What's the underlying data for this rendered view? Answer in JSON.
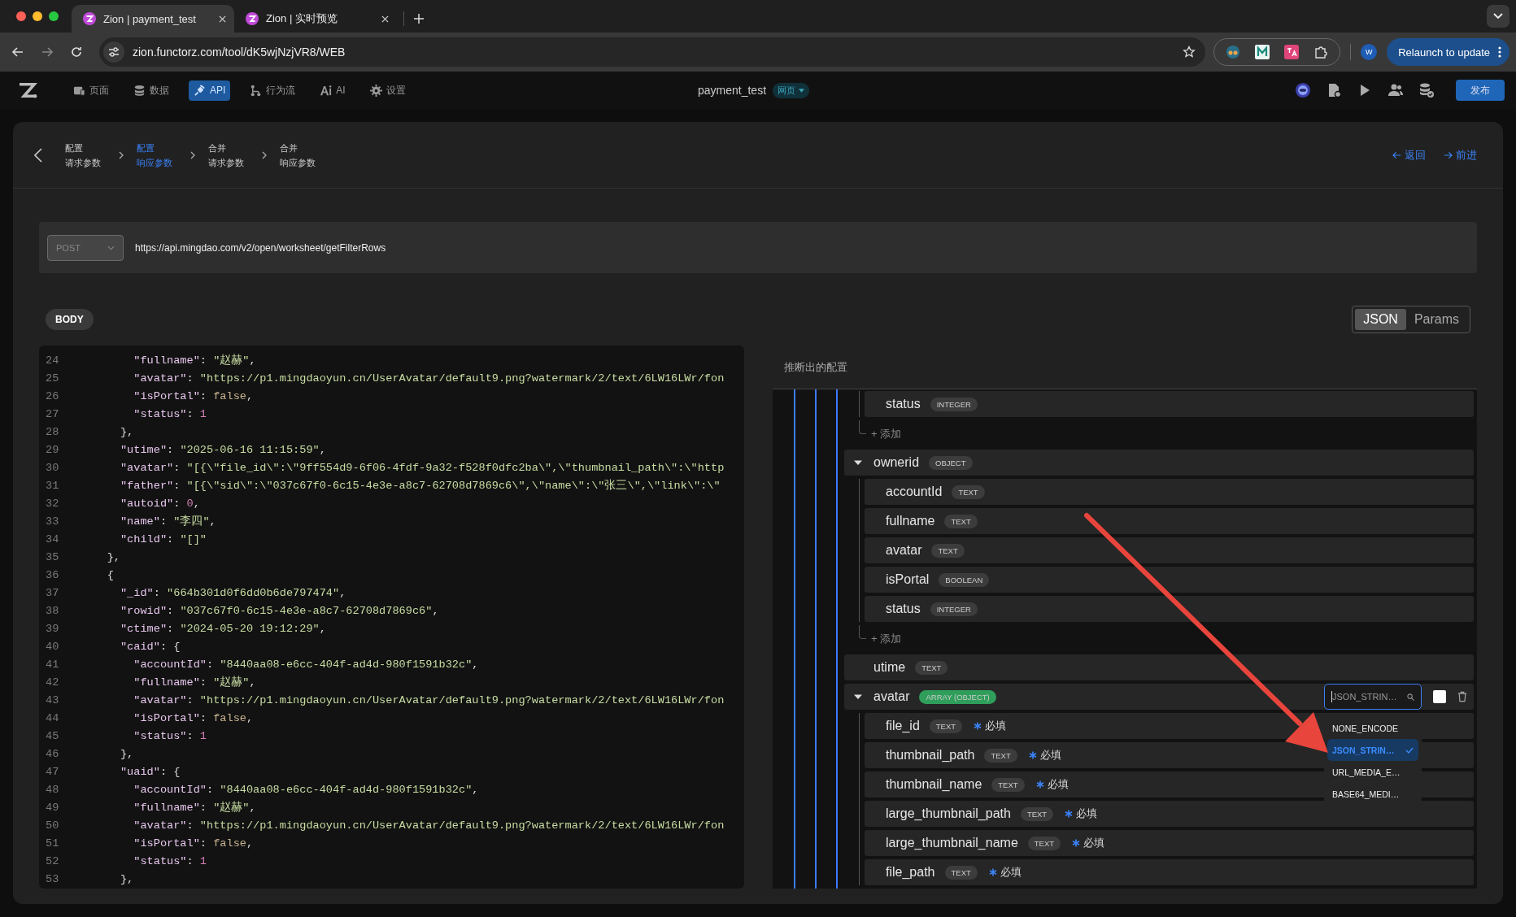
{
  "browser": {
    "tabs": [
      {
        "title": "Zion | payment_test",
        "selected": true
      },
      {
        "title": "Zion | 实时预览",
        "selected": false
      }
    ],
    "url": "zion.functorz.com/tool/dK5wjNzjVR8/WEB",
    "profile_initial": "W",
    "relaunch_label": "Relaunch to update"
  },
  "app_header": {
    "nav": [
      {
        "label": "页面",
        "selected": false
      },
      {
        "label": "数据",
        "selected": false
      },
      {
        "label": "API",
        "selected": true
      },
      {
        "label": "行为流",
        "selected": false
      },
      {
        "label": "AI",
        "selected": false
      },
      {
        "label": "设置",
        "selected": false
      }
    ],
    "project_title": "payment_test",
    "project_tag": "网页",
    "publish_label": "发布"
  },
  "steps": [
    {
      "title": "配置",
      "subtitle": "请求参数",
      "selected": false
    },
    {
      "title": "配置",
      "subtitle": "响应参数",
      "selected": true
    },
    {
      "title": "合并",
      "subtitle": "请求参数",
      "selected": false
    },
    {
      "title": "合并",
      "subtitle": "响应参数",
      "selected": false
    }
  ],
  "back_label": "返回",
  "forward_label": "前进",
  "request": {
    "method": "POST",
    "url": "https://api.mingdao.com/v2/open/worksheet/getFilterRows"
  },
  "body_label": "BODY",
  "format_toggle": [
    {
      "label": "JSON",
      "selected": true
    },
    {
      "label": "Params",
      "selected": false
    }
  ],
  "code_lines": [
    {
      "n": "24",
      "code": "        \"fullname\": \"赵赫\","
    },
    {
      "n": "25",
      "code": "        \"avatar\": \"https://p1.mingdaoyun.cn/UserAvatar/default9.png?watermark/2/text/6LW16LWr/fon"
    },
    {
      "n": "26",
      "code": "        \"isPortal\": false,"
    },
    {
      "n": "27",
      "code": "        \"status\": 1"
    },
    {
      "n": "28",
      "code": "      },"
    },
    {
      "n": "29",
      "code": "      \"utime\": \"2025-06-16 11:15:59\","
    },
    {
      "n": "30",
      "code": "      \"avatar\": \"[{\\\"file_id\\\":\\\"9ff554d9-6f06-4fdf-9a32-f528f0dfc2ba\\\",\\\"thumbnail_path\\\":\\\"http"
    },
    {
      "n": "31",
      "code": "      \"father\": \"[{\\\"sid\\\":\\\"037c67f0-6c15-4e3e-a8c7-62708d7869c6\\\",\\\"name\\\":\\\"张三\\\",\\\"link\\\":\\\""
    },
    {
      "n": "32",
      "code": "      \"autoid\": 0,"
    },
    {
      "n": "33",
      "code": "      \"name\": \"李四\","
    },
    {
      "n": "34",
      "code": "      \"child\": \"[]\""
    },
    {
      "n": "35",
      "code": "    },"
    },
    {
      "n": "36",
      "code": "    {"
    },
    {
      "n": "37",
      "code": "      \"_id\": \"664b301d0f6dd0b6de797474\","
    },
    {
      "n": "38",
      "code": "      \"rowid\": \"037c67f0-6c15-4e3e-a8c7-62708d7869c6\","
    },
    {
      "n": "39",
      "code": "      \"ctime\": \"2024-05-20 19:12:29\","
    },
    {
      "n": "40",
      "code": "      \"caid\": {"
    },
    {
      "n": "41",
      "code": "        \"accountId\": \"8440aa08-e6cc-404f-ad4d-980f1591b32c\","
    },
    {
      "n": "42",
      "code": "        \"fullname\": \"赵赫\","
    },
    {
      "n": "43",
      "code": "        \"avatar\": \"https://p1.mingdaoyun.cn/UserAvatar/default9.png?watermark/2/text/6LW16LWr/fon"
    },
    {
      "n": "44",
      "code": "        \"isPortal\": false,"
    },
    {
      "n": "45",
      "code": "        \"status\": 1"
    },
    {
      "n": "46",
      "code": "      },"
    },
    {
      "n": "47",
      "code": "      \"uaid\": {"
    },
    {
      "n": "48",
      "code": "        \"accountId\": \"8440aa08-e6cc-404f-ad4d-980f1591b32c\","
    },
    {
      "n": "49",
      "code": "        \"fullname\": \"赵赫\","
    },
    {
      "n": "50",
      "code": "        \"avatar\": \"https://p1.mingdaoyun.cn/UserAvatar/default9.png?watermark/2/text/6LW16LWr/fon"
    },
    {
      "n": "51",
      "code": "        \"isPortal\": false,"
    },
    {
      "n": "52",
      "code": "        \"status\": 1"
    },
    {
      "n": "53",
      "code": "      },"
    }
  ],
  "inferred": {
    "title": "推断出的配置",
    "tree": [
      {
        "children": [
          {
            "name": "status",
            "type": "INTEGER",
            "color": "#3c3c3c",
            "required": false
          }
        ],
        "add_label": "+ 添加"
      },
      {
        "name": "ownerid",
        "type": "OBJECT",
        "color": "#3c3c3c",
        "expanded": true,
        "children": [
          {
            "name": "accountId",
            "type": "TEXT",
            "color": "#3c3c3c",
            "required": false
          },
          {
            "name": "fullname",
            "type": "TEXT",
            "color": "#3c3c3c",
            "required": false
          },
          {
            "name": "avatar",
            "type": "TEXT",
            "color": "#3c3c3c",
            "required": false
          },
          {
            "name": "isPortal",
            "type": "BOOLEAN",
            "color": "#3c3c3c",
            "required": false
          },
          {
            "name": "status",
            "type": "INTEGER",
            "color": "#3c3c3c",
            "required": false
          }
        ],
        "add_label": "+ 添加"
      },
      {
        "name": "utime",
        "type": "TEXT",
        "color": "#3c3c3c"
      },
      {
        "name": "avatar",
        "type": "ARRAY (OBJECT)",
        "color": "#2f9e5b",
        "expanded": true,
        "encode": {
          "value": "JSON_STRIN…",
          "checked": false,
          "dropdown_open": true,
          "options": [
            {
              "label": "NONE_ENCODE",
              "selected": false
            },
            {
              "label": "JSON_STRIN…",
              "selected": true
            },
            {
              "label": "URL_MEDIA_E…",
              "selected": false
            },
            {
              "label": "BASE64_MEDI…",
              "selected": false
            }
          ]
        },
        "children": [
          {
            "name": "file_id",
            "type": "TEXT",
            "color": "#3c3c3c",
            "required": true,
            "required_label": "必填"
          },
          {
            "name": "thumbnail_path",
            "type": "TEXT",
            "color": "#3c3c3c",
            "required": true,
            "required_label": "必填"
          },
          {
            "name": "thumbnail_name",
            "type": "TEXT",
            "color": "#3c3c3c",
            "required": true,
            "required_label": "必填"
          },
          {
            "name": "large_thumbnail_path",
            "type": "TEXT",
            "color": "#3c3c3c",
            "required": true,
            "required_label": "必填"
          },
          {
            "name": "large_thumbnail_name",
            "type": "TEXT",
            "color": "#3c3c3c",
            "required": true,
            "required_label": "必填"
          },
          {
            "name": "file_path",
            "type": "TEXT",
            "color": "#3c3c3c",
            "required": true,
            "required_label": "必填"
          }
        ]
      }
    ]
  }
}
